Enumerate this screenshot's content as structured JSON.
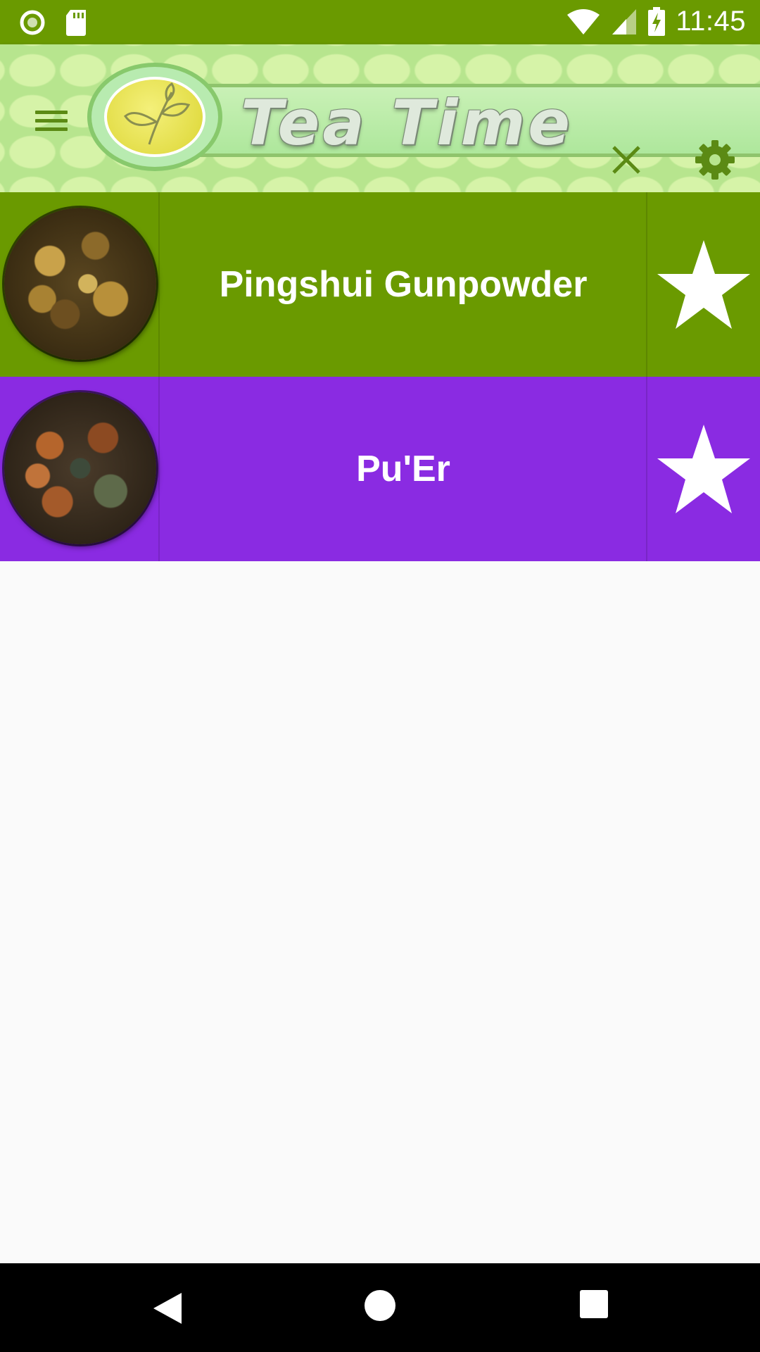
{
  "status_bar": {
    "time": "11:45",
    "icons": [
      "record-icon",
      "sd-card-icon",
      "wifi-icon",
      "signal-icon",
      "battery-charging-icon"
    ]
  },
  "toolbar": {
    "title": "Tea Time",
    "menu_icon": "hamburger-menu-icon",
    "close_icon": "close-icon",
    "settings_icon": "gear-icon"
  },
  "teas": [
    {
      "name": "Pingshui Gunpowder",
      "color": "#6a9a00",
      "favorite_icon": "star-icon"
    },
    {
      "name": "Pu'Er",
      "color": "#8a2be2",
      "favorite_icon": "star-icon"
    }
  ],
  "nav_bar": {
    "icons": [
      "back-icon",
      "home-icon",
      "recents-icon"
    ]
  },
  "colors": {
    "status_bar": "#6a9a00",
    "accent_green": "#5b8a14",
    "background": "#fafafa"
  }
}
